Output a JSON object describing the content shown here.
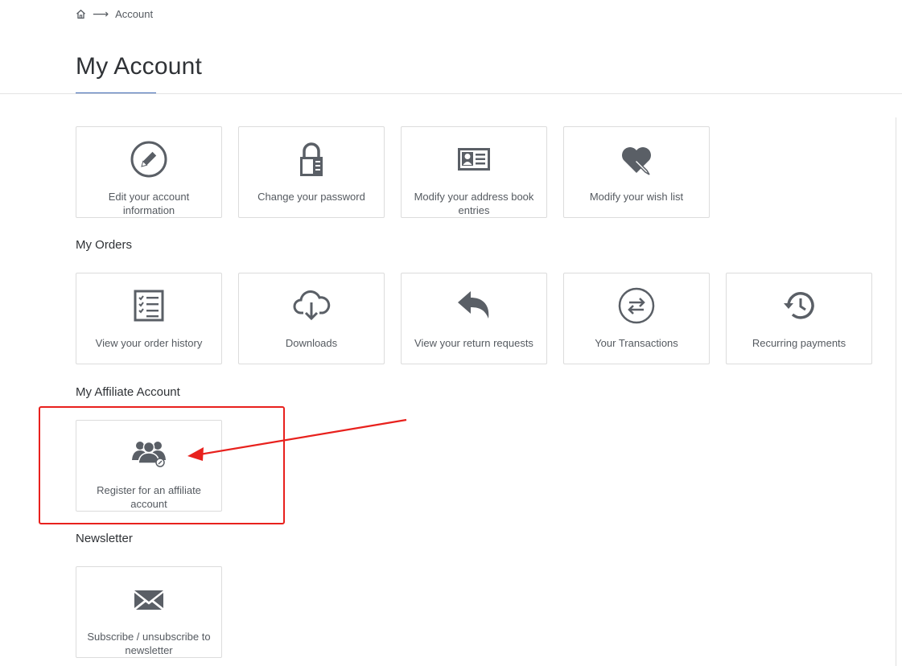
{
  "breadcrumb": {
    "home_icon": "home-icon",
    "separator": "⟶",
    "current": "Account"
  },
  "page": {
    "title": "My Account"
  },
  "account_section": {
    "tiles": [
      {
        "icon": "pencil-circle-icon",
        "label": "Edit your account information"
      },
      {
        "icon": "lock-icon",
        "label": "Change your password"
      },
      {
        "icon": "address-card-icon",
        "label": "Modify your address book entries"
      },
      {
        "icon": "heart-pencil-icon",
        "label": "Modify your wish list"
      }
    ]
  },
  "orders_section": {
    "heading": "My Orders",
    "tiles": [
      {
        "icon": "checklist-icon",
        "label": "View your order history"
      },
      {
        "icon": "cloud-download-icon",
        "label": "Downloads"
      },
      {
        "icon": "reply-arrow-icon",
        "label": "View your return requests"
      },
      {
        "icon": "exchange-arrows-icon",
        "label": "Your Transactions"
      },
      {
        "icon": "history-clock-icon",
        "label": "Recurring payments"
      }
    ]
  },
  "affiliate_section": {
    "heading": "My Affiliate Account",
    "tiles": [
      {
        "icon": "users-group-icon",
        "label": "Register for an affiliate account"
      }
    ]
  },
  "newsletter_section": {
    "heading": "Newsletter",
    "tiles": [
      {
        "icon": "envelope-icon",
        "label": "Subscribe / unsubscribe to newsletter"
      }
    ]
  },
  "annotation": {
    "color": "#e8211d"
  },
  "colors": {
    "icon": "#5a5f66",
    "accent": "#3c67b3",
    "tile_border": "#dcdcdc"
  }
}
